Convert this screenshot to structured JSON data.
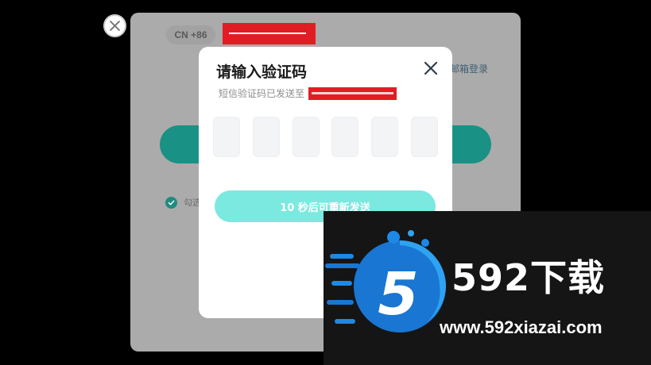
{
  "login_card": {
    "country_code": "CN +86",
    "email_login_link": "邮箱登录",
    "agree_text": "勾选"
  },
  "verify_modal": {
    "title": "请输入验证码",
    "sent_to_label": "短信验证码已发送至",
    "code_length": 6,
    "resend_label": "10 秒后可重新发送",
    "resend_countdown_seconds": 10
  },
  "watermark": {
    "brand": "592下载",
    "logo_digit": "5",
    "url": "www.592xiazai.com"
  },
  "colors": {
    "backdrop": "#000000",
    "card_dimmed": "#ababab",
    "primary_dimmed": "#1a9185",
    "resend_button": "#7be9df",
    "redaction": "#e11d24",
    "logo_blue": "#1a73e8"
  },
  "icons": {
    "outer_close": "close-icon",
    "modal_close": "close-icon",
    "agree": "check-circle-icon"
  }
}
